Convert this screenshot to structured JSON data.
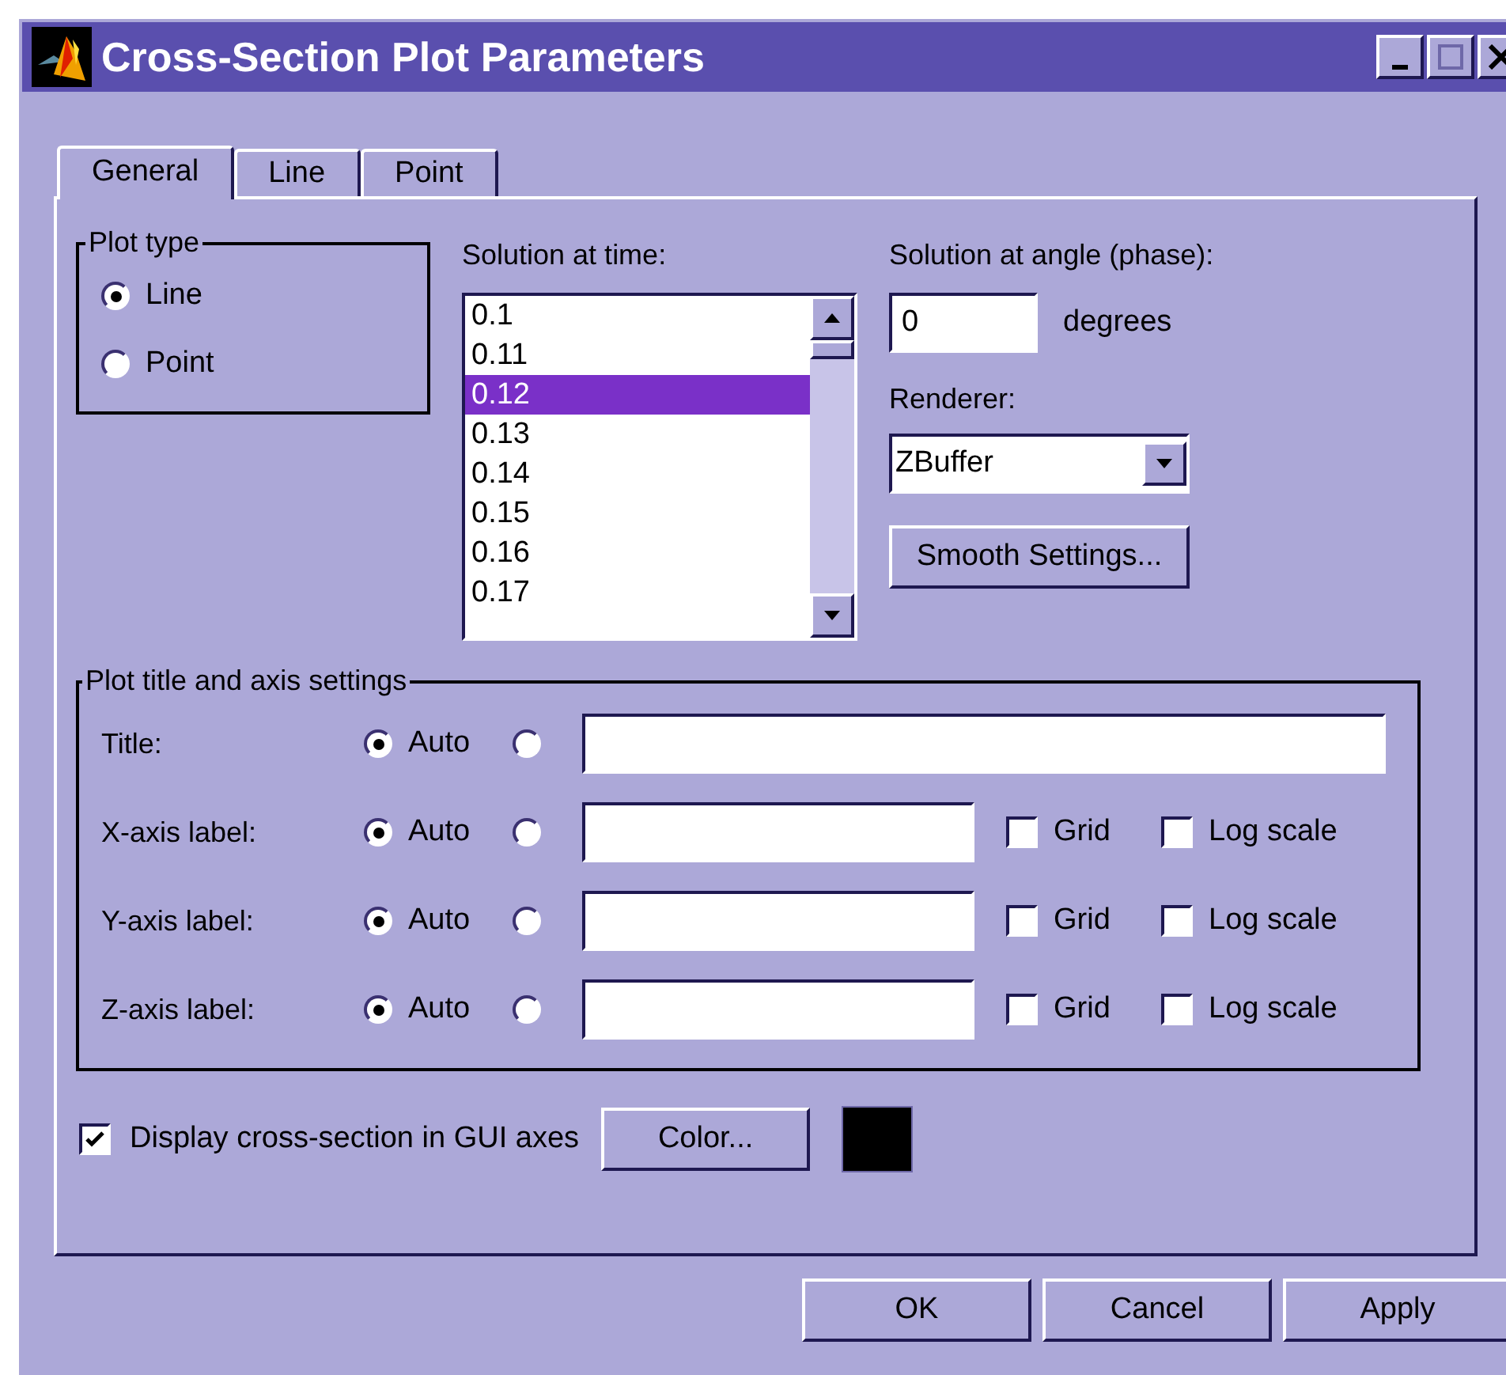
{
  "window": {
    "title": "Cross-Section Plot Parameters"
  },
  "tabs": [
    {
      "label": "General",
      "selected": true
    },
    {
      "label": "Line",
      "selected": false
    },
    {
      "label": "Point",
      "selected": false
    }
  ],
  "plot_type": {
    "title": "Plot type",
    "options": [
      {
        "label": "Line",
        "selected": true
      },
      {
        "label": "Point",
        "selected": false
      }
    ]
  },
  "solution_time": {
    "label": "Solution at time:",
    "items": [
      {
        "label": "0.1",
        "selected": false
      },
      {
        "label": "0.11",
        "selected": false
      },
      {
        "label": "0.12",
        "selected": true
      },
      {
        "label": "0.13",
        "selected": false
      },
      {
        "label": "0.14",
        "selected": false
      },
      {
        "label": "0.15",
        "selected": false
      },
      {
        "label": "0.16",
        "selected": false
      },
      {
        "label": "0.17",
        "selected": false
      }
    ]
  },
  "angle": {
    "label": "Solution at angle (phase):",
    "value": "0",
    "unit": "degrees"
  },
  "renderer": {
    "label": "Renderer:",
    "value": "ZBuffer"
  },
  "smooth_button": "Smooth Settings...",
  "axis_settings": {
    "title": "Plot title and axis settings",
    "rows": [
      {
        "kind": "title",
        "label": "Title:",
        "auto": {
          "label": "Auto",
          "selected": true
        },
        "custom": {
          "selected": false
        }
      },
      {
        "kind": "axis",
        "label": "X-axis label:",
        "auto": {
          "label": "Auto",
          "selected": true
        },
        "custom": {
          "selected": false
        },
        "grid": {
          "label": "Grid",
          "checked": false
        },
        "log_scale": {
          "label": "Log scale",
          "checked": false
        }
      },
      {
        "kind": "axis",
        "label": "Y-axis label:",
        "auto": {
          "label": "Auto",
          "selected": true
        },
        "custom": {
          "selected": false
        },
        "grid": {
          "label": "Grid",
          "checked": false
        },
        "log_scale": {
          "label": "Log scale",
          "checked": false
        }
      },
      {
        "kind": "axis",
        "label": "Z-axis label:",
        "auto": {
          "label": "Auto",
          "selected": true
        },
        "custom": {
          "selected": false
        },
        "grid": {
          "label": "Grid",
          "checked": false
        },
        "log_scale": {
          "label": "Log scale",
          "checked": false
        }
      }
    ]
  },
  "display": {
    "label": "Display cross-section in GUI axes",
    "checked": true,
    "button": "Color...",
    "color": "#000000"
  },
  "buttons": [
    "OK",
    "Cancel",
    "Apply"
  ]
}
